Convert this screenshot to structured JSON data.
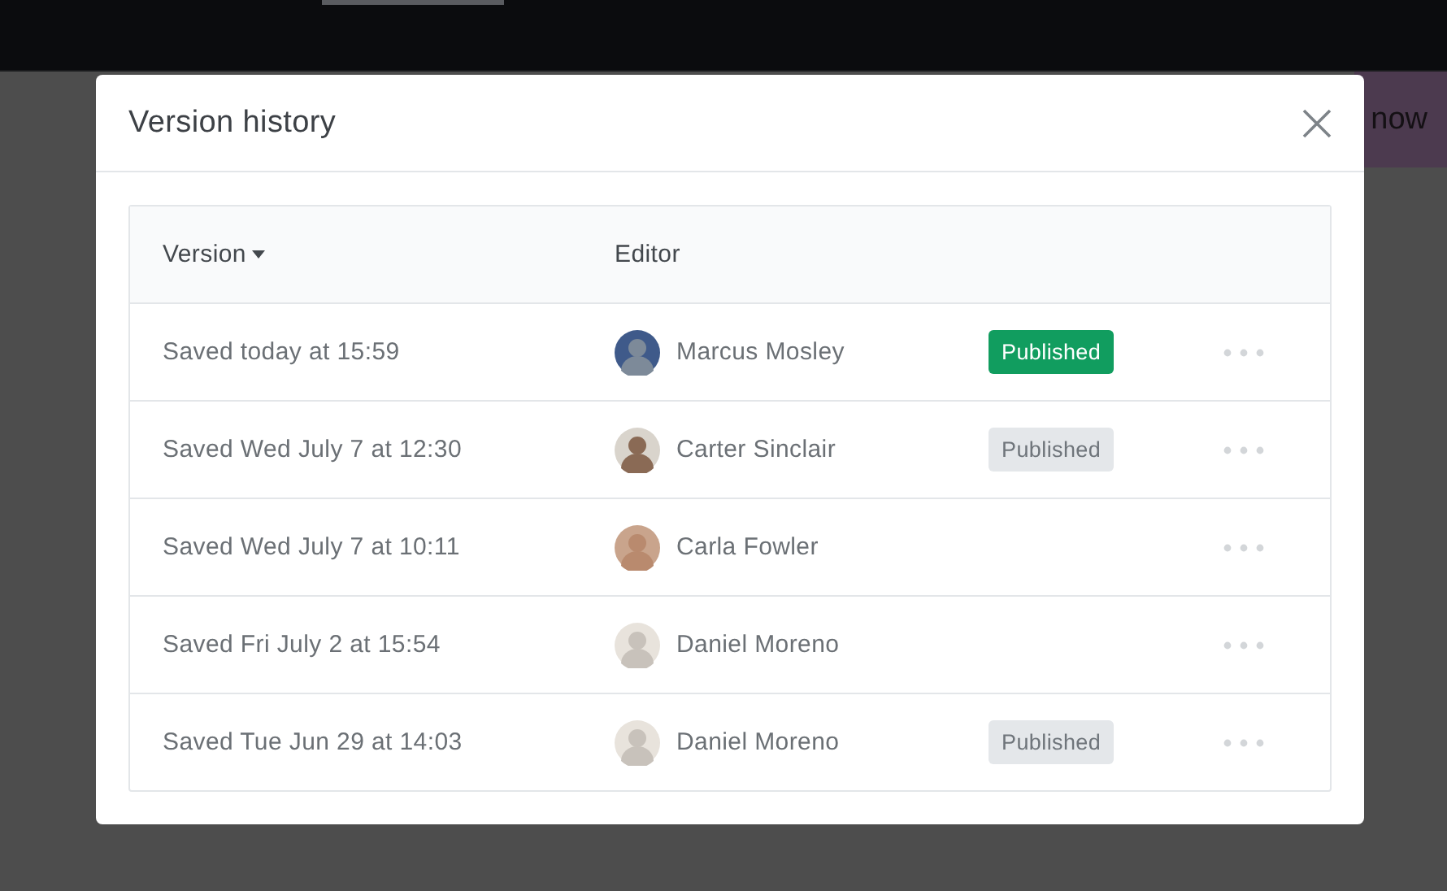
{
  "background": {
    "button": "now"
  },
  "dialog": {
    "title": "Version history",
    "table": {
      "columns": [
        {
          "label": "Version",
          "sorted": true
        },
        {
          "label": "Editor",
          "sorted": false
        }
      ],
      "rows": [
        {
          "version": "Saved today at 15:59",
          "editor": "Marcus Mosley",
          "badge": {
            "label": "Published",
            "current": true
          }
        },
        {
          "version": "Saved Wed July 7 at 12:30",
          "editor": "Carter Sinclair",
          "badge": {
            "label": "Published",
            "current": false
          }
        },
        {
          "version": "Saved Wed July 7 at 10:11",
          "editor": "Carla Fowler"
        },
        {
          "version": "Saved Fri July 2 at 15:54",
          "editor": "Daniel Moreno"
        },
        {
          "version": "Saved Tue Jun 29 at 14:03",
          "editor": "Daniel Moreno",
          "badge": {
            "label": "Published",
            "current": false
          }
        }
      ]
    }
  }
}
